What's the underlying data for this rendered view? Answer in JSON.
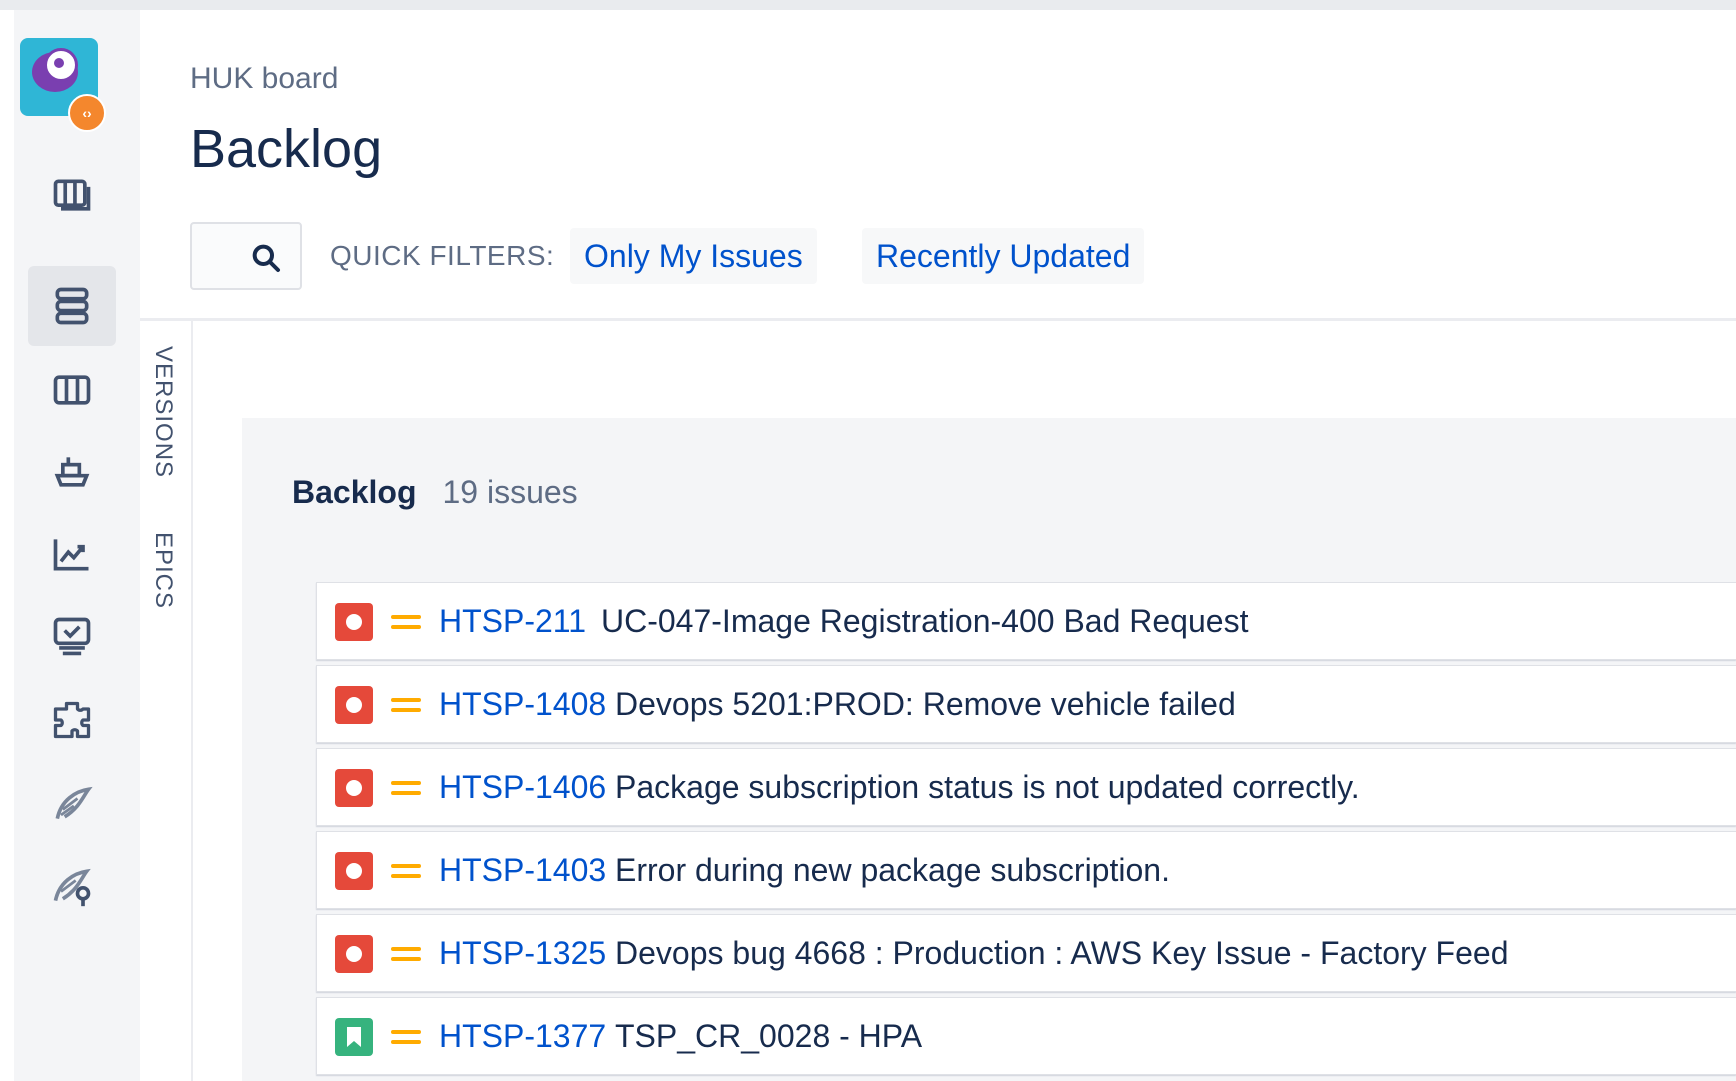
{
  "header": {
    "breadcrumb": "HUK board",
    "title": "Backlog"
  },
  "quick_filters": {
    "label": "QUICK FILTERS:",
    "filters": [
      "Only My Issues",
      "Recently Updated"
    ]
  },
  "side_tabs": [
    "VERSIONS",
    "EPICS"
  ],
  "sidebar": {
    "icons": [
      "backlog-board-icon",
      "backlog-icon",
      "active-sprints-icon",
      "releases-icon",
      "reports-icon",
      "issues-icon",
      "components-icon",
      "plugin-icon",
      "plugin-settings-icon"
    ],
    "active": "backlog-icon"
  },
  "backlog": {
    "name": "Backlog",
    "count": "19 issues",
    "issues": [
      {
        "type": "bug",
        "priority": "medium",
        "key": "HTSP-211",
        "summary": "UC-047-Image Registration-400 Bad Request"
      },
      {
        "type": "bug",
        "priority": "medium",
        "key": "HTSP-1408",
        "summary": "Devops 5201:PROD: Remove vehicle failed"
      },
      {
        "type": "bug",
        "priority": "medium",
        "key": "HTSP-1406",
        "summary": "Package subscription status is not updated correctly."
      },
      {
        "type": "bug",
        "priority": "medium",
        "key": "HTSP-1403",
        "summary": "Error during new package subscription."
      },
      {
        "type": "bug",
        "priority": "medium",
        "key": "HTSP-1325",
        "summary": "Devops bug 4668 : Production : AWS Key Issue - Factory Feed"
      },
      {
        "type": "story",
        "priority": "medium",
        "key": "HTSP-1377",
        "summary": "TSP_CR_0028 - HPA"
      }
    ]
  },
  "colors": {
    "link": "#0052cc",
    "bug": "#e5493a",
    "story": "#36b37e",
    "priority_medium": "#ffab00"
  }
}
